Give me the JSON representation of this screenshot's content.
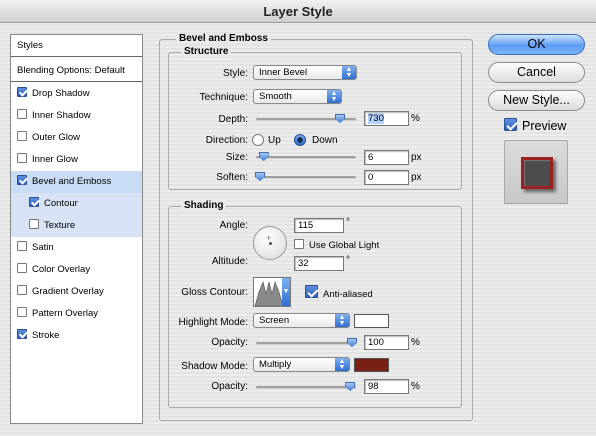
{
  "window": {
    "title": "Layer Style"
  },
  "sidebar": {
    "styles_label": "Styles",
    "blending_label": "Blending Options: Default",
    "items": [
      {
        "label": "Drop Shadow",
        "checked": true
      },
      {
        "label": "Inner Shadow",
        "checked": false
      },
      {
        "label": "Outer Glow",
        "checked": false
      },
      {
        "label": "Inner Glow",
        "checked": false
      },
      {
        "label": "Bevel and Emboss",
        "checked": true
      },
      {
        "label": "Contour",
        "checked": true
      },
      {
        "label": "Texture",
        "checked": false
      },
      {
        "label": "Satin",
        "checked": false
      },
      {
        "label": "Color Overlay",
        "checked": false
      },
      {
        "label": "Gradient Overlay",
        "checked": false
      },
      {
        "label": "Pattern Overlay",
        "checked": false
      },
      {
        "label": "Stroke",
        "checked": true
      }
    ]
  },
  "bevel": {
    "title": "Bevel and Emboss",
    "structure": {
      "title": "Structure",
      "style_label": "Style:",
      "style_value": "Inner Bevel",
      "technique_label": "Technique:",
      "technique_value": "Smooth",
      "depth_label": "Depth:",
      "depth_value": "730",
      "depth_unit": "%",
      "depth_level": 0.87,
      "direction_label": "Direction:",
      "dir_up": "Up",
      "dir_down": "Down",
      "direction_selected": "Down",
      "size_label": "Size:",
      "size_value": "6",
      "size_unit": "px",
      "size_level": 0.04,
      "soften_label": "Soften:",
      "soften_value": "0",
      "soften_unit": "px",
      "soften_level": 0.0
    },
    "shading": {
      "title": "Shading",
      "angle_label": "Angle:",
      "angle_value": "115",
      "angle_unit": "°",
      "global_light_label": "Use Global Light",
      "global_light_checked": false,
      "altitude_label": "Altitude:",
      "altitude_value": "32",
      "altitude_unit": "°",
      "gloss_label": "Gloss Contour:",
      "antialias_label": "Anti-aliased",
      "antialias_checked": true,
      "highlight_mode_label": "Highlight Mode:",
      "highlight_mode_value": "Screen",
      "highlight_color": "#ffffff",
      "opacity_label": "Opacity:",
      "highlight_opacity": "100",
      "highlight_opacity_level": 1.0,
      "shadow_mode_label": "Shadow Mode:",
      "shadow_mode_value": "Multiply",
      "shadow_color": "#7a1f14",
      "shadow_opacity": "98",
      "shadow_opacity_level": 0.98,
      "pct": "%"
    }
  },
  "buttons": {
    "ok": "OK",
    "cancel": "Cancel",
    "new_style": "New Style..."
  },
  "preview": {
    "label": "Preview",
    "checked": true
  }
}
